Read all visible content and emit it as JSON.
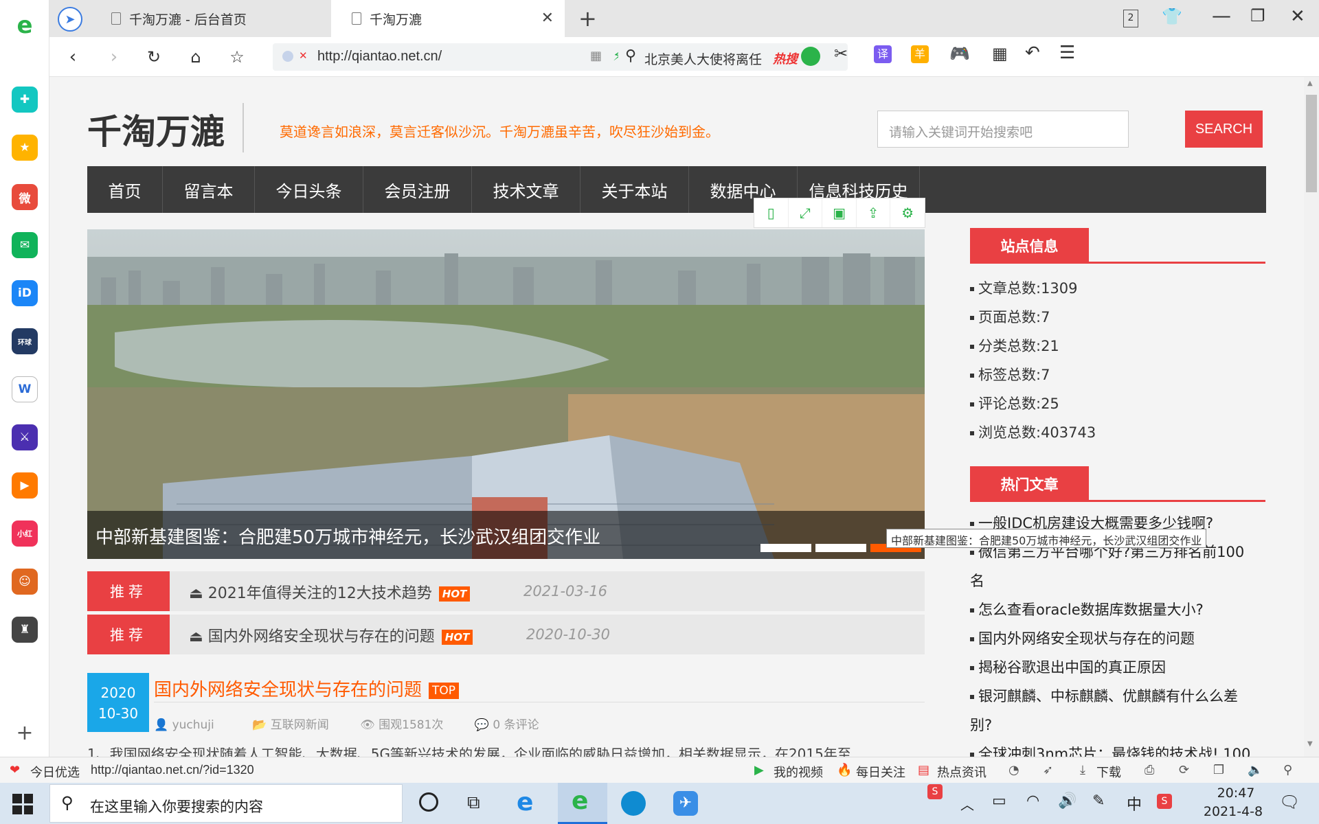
{
  "browser": {
    "tabs": [
      {
        "label": "千淘万漉 - 后台首页"
      },
      {
        "label": "千淘万漉",
        "active": true
      }
    ],
    "tab_count": "2",
    "url": "http://qiantao.net.cn/",
    "search_hint": "北京美人大使将离任",
    "search_hot": "热搜"
  },
  "site": {
    "logo": "千淘万漉",
    "slogan": "莫道谗言如浪深，莫言迁客似沙沉。千淘万漉虽辛苦，吹尽狂沙始到金。",
    "search_placeholder": "请输入关键词开始搜索吧",
    "search_button": "SEARCH",
    "nav": [
      "首页",
      "留言本",
      "今日头条",
      "会员注册",
      "技术文章",
      "关于本站",
      "数据中心",
      "信息科技历史"
    ],
    "slider_caption": "中部新基建图鉴：合肥建50万城市神经元，长沙武汉组团交作业",
    "tooltip": "中部新基建图鉴：合肥建50万城市神经元，长沙武汉组团交作业",
    "recommend": [
      {
        "tag": "推荐",
        "title": "2021年值得关注的12大技术趋势",
        "badge": "HOT",
        "date": "2021-03-16"
      },
      {
        "tag": "推荐",
        "title": "国内外网络安全现状与存在的问题",
        "badge": "HOT",
        "date": "2020-10-30"
      }
    ],
    "post": {
      "year": "2020",
      "month_day": "10-30",
      "title": "国内外网络安全现状与存在的问题",
      "badge": "TOP",
      "author": "yuchuji",
      "category": "互联网新闻",
      "views": "围观1581次",
      "comments": "0 条评论",
      "excerpt": "1、我国网络安全现状随着人工智能、大数据、5G等新兴技术的发展，企业面临的威胁日益增加，相关数据显示，在2015年至"
    },
    "site_info_title": "站点信息",
    "site_info": [
      "文章总数:1309",
      "页面总数:7",
      "分类总数:21",
      "标签总数:7",
      "评论总数:25",
      "浏览总数:403743"
    ],
    "hot_title": "热门文章",
    "hot_posts": [
      "一般IDC机房建设大概需要多少钱啊?",
      "微信第三方平台哪个好?第三方排名前100名",
      "怎么查看oracle数据库数据量大小?",
      "国内外网络安全现状与存在的问题",
      "揭秘谷歌退出中国的真正原因",
      "银河麒麟、中标麒麟、优麒麟有什么么差别?",
      "全球冲刺3nm芯片：最烧钱的技术战! 100"
    ]
  },
  "statusbar": {
    "left_label": "今日优选",
    "link": "http://qiantao.net.cn/?id=1320",
    "items": [
      "我的视频",
      "每日关注",
      "热点资讯",
      "下载"
    ]
  },
  "taskbar": {
    "search_placeholder": "在这里输入你要搜索的内容",
    "time": "20:47",
    "date": "2021-4-8",
    "ime": "中"
  },
  "colors": {
    "accent": "#e94043",
    "orange": "#ff5a00",
    "date_blue": "#1aa7e8",
    "nav": "#3b3b3b"
  }
}
